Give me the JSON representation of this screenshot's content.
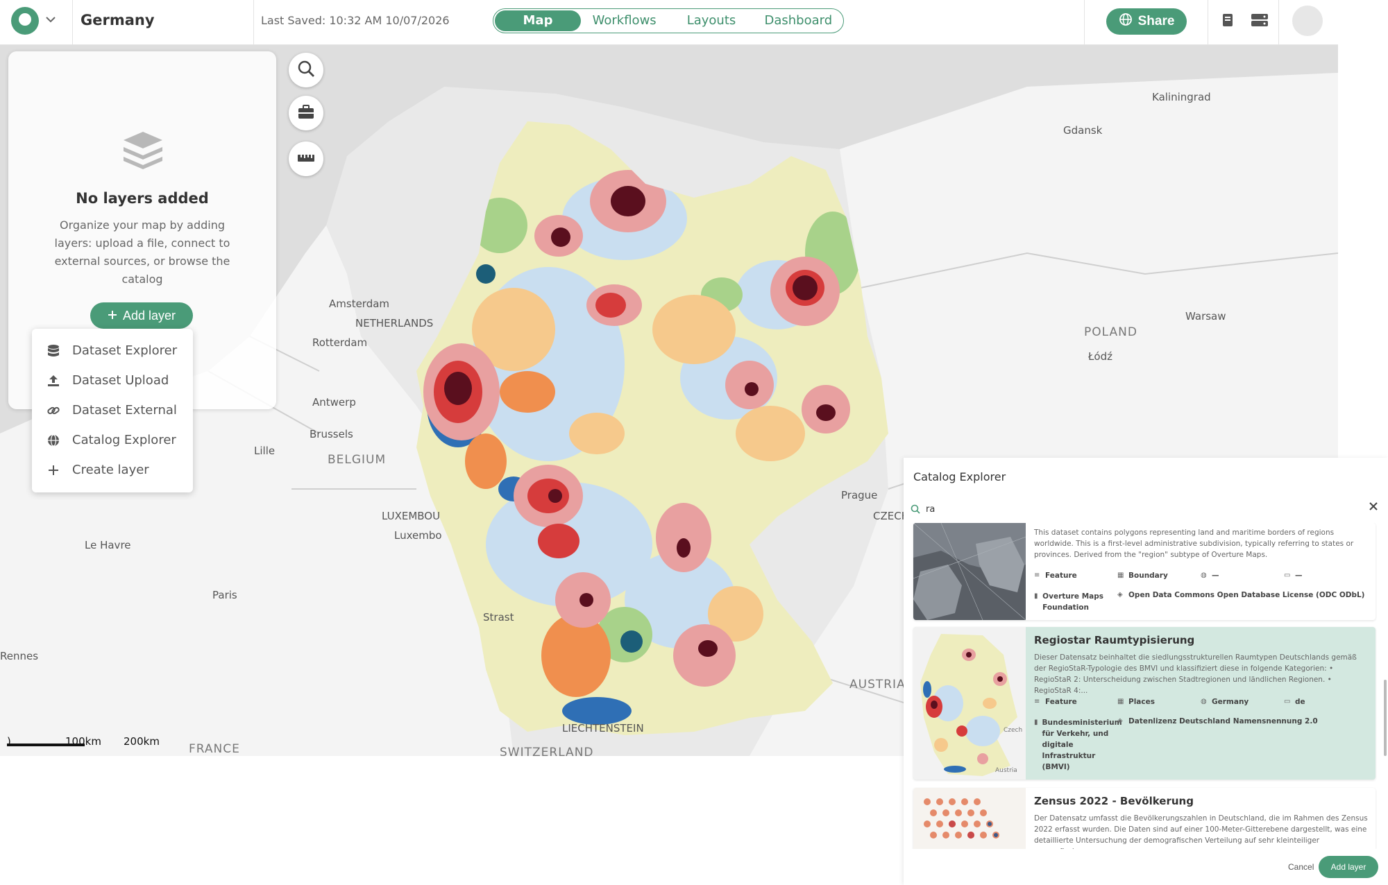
{
  "topbar": {
    "project_name": "Germany",
    "last_saved": "Last Saved: 10:32 AM 10/07/2026",
    "tabs": [
      {
        "label": "Map",
        "active": true
      },
      {
        "label": "Workflows",
        "active": false
      },
      {
        "label": "Layouts",
        "active": false
      },
      {
        "label": "Dashboard",
        "active": false
      }
    ],
    "share_label": "Share",
    "icons": [
      "logo-icon",
      "chevron-down-icon",
      "globe-icon",
      "book-icon",
      "server-icon",
      "avatar"
    ]
  },
  "colors": {
    "accent": "#4a9b78",
    "selected_card": "#d3e8e0",
    "choropleth": [
      "#f1f0c8",
      "#c9def0",
      "#a8d28a",
      "#f6c98c",
      "#f08f4e",
      "#e8a0a0",
      "#d63c3c",
      "#5a0f1e",
      "#2f6fb5",
      "#1c5e78"
    ]
  },
  "layers_panel": {
    "title": "No layers added",
    "description": "Organize your map by adding layers: upload a file, connect to external sources, or browse the catalog",
    "add_layer_label": "Add layer"
  },
  "add_menu": {
    "items": [
      {
        "label": "Dataset Explorer",
        "icon": "database-icon"
      },
      {
        "label": "Dataset Upload",
        "icon": "upload-icon"
      },
      {
        "label": "Dataset External",
        "icon": "link-icon"
      },
      {
        "label": "Catalog Explorer",
        "icon": "globe-icon"
      },
      {
        "label": "Create layer",
        "icon": "plus-icon"
      }
    ]
  },
  "map": {
    "labels": {
      "kaliningrad": "Kaliningrad",
      "gdansk": "Gdansk",
      "amsterdam": "Amsterdam",
      "netherlands": "NETHERLANDS",
      "rotterdam": "Rotterdam",
      "warsaw": "Warsaw",
      "poland": "POLAND",
      "lodz": "Łódź",
      "antwerp": "Antwerp",
      "brussels": "Brussels",
      "belgium": "BELGIUM",
      "lille": "Lille",
      "prague": "Prague",
      "czech": "CZECH",
      "luxembourg_country": "LUXEMBOU",
      "luxembourg_city": "Luxembo",
      "le_havre": "Le Havre",
      "paris": "Paris",
      "strasbourg": "Strast",
      "rennes": "Rennes",
      "austria": "AUSTRIA",
      "liechtenstein": "LIECHTENSTEIN",
      "switzerland": "SWITZERLAND",
      "france": "FRANCE"
    },
    "scale": {
      "zero": ")",
      "mid": "100km",
      "max": "200km"
    }
  },
  "catalog": {
    "title": "Catalog Explorer",
    "search_value": "ra",
    "cards": [
      {
        "title": "",
        "description": "This dataset contains polygons representing land and maritime borders of regions worldwide. This is a first-level administrative subdivision, typically referring to states or provinces. Derived from the \"region\" subtype of Overture Maps.",
        "type": "Feature",
        "category": "Boundary",
        "coverage": "—",
        "format": "—",
        "provider": "Overture Maps Foundation",
        "license": "Open Data Commons Open Database License (ODC ODbL)"
      },
      {
        "title": "Regiostar Raumtypisierung",
        "description": "Dieser Datensatz beinhaltet die siedlungsstrukturellen Raumtypen Deutschlands gemäß der RegioStaR-Typologie des BMVI und klassifiziert diese in folgende Kategorien: • RegioStaR 2: Unterscheidung zwischen Stadtregionen und ländlichen Regionen. • RegioStaR 4:...",
        "type": "Feature",
        "category": "Places",
        "coverage": "Germany",
        "format": "de",
        "provider": "Bundesministerium für Verkehr, und digitale Infrastruktur (BMVI)",
        "license": "Datenlizenz Deutschland Namensnennung 2.0",
        "thumb_labels": {
          "czech": "Czech",
          "austria": "Austria"
        }
      },
      {
        "title": "Zensus 2022 - Bevölkerung",
        "description": "Der Datensatz umfasst die Bevölkerungszahlen in Deutschland, die im Rahmen des Zensus 2022 erfasst wurden. Die Daten sind auf einer 100-Meter-Gitterebene dargestellt, was eine detaillierte Untersuchung der demografischen Verteilung auf sehr kleinteiliger geografischen..."
      }
    ],
    "cancel_label": "Cancel",
    "add_label": "Add layer"
  }
}
